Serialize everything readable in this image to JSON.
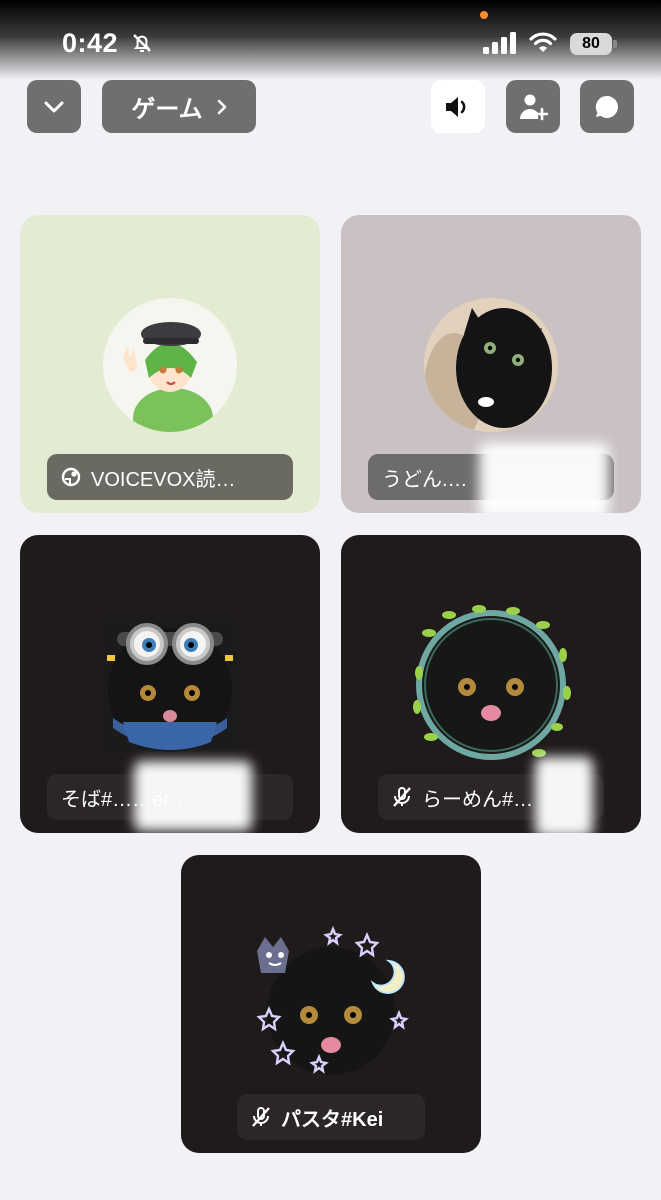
{
  "status_bar": {
    "time": "0:42",
    "battery": "80"
  },
  "header": {
    "channel_label": "ゲーム",
    "speaker_active": true
  },
  "participants": [
    {
      "name": "VOICEVOX読…",
      "status_icon": "bot-icon",
      "tile_color": "#e3ecd2",
      "plate_color": "#6b6a62"
    },
    {
      "name": "うどん.…",
      "status_icon": "",
      "tile_color": "#cac2c2",
      "plate_color": "#6e6b6b"
    },
    {
      "name": "そば#……er…",
      "status_icon": "",
      "tile_color": "#1f1b1b",
      "plate_color": "#2b2727"
    },
    {
      "name": "らーめん#…",
      "status_icon": "mic-muted-icon",
      "tile_color": "#1f1b1b",
      "plate_color": "#2b2727"
    },
    {
      "name": "パスタ#Kei",
      "status_icon": "mic-muted-icon",
      "tile_color": "#1f1b1b",
      "plate_color": "#2b2727"
    }
  ]
}
